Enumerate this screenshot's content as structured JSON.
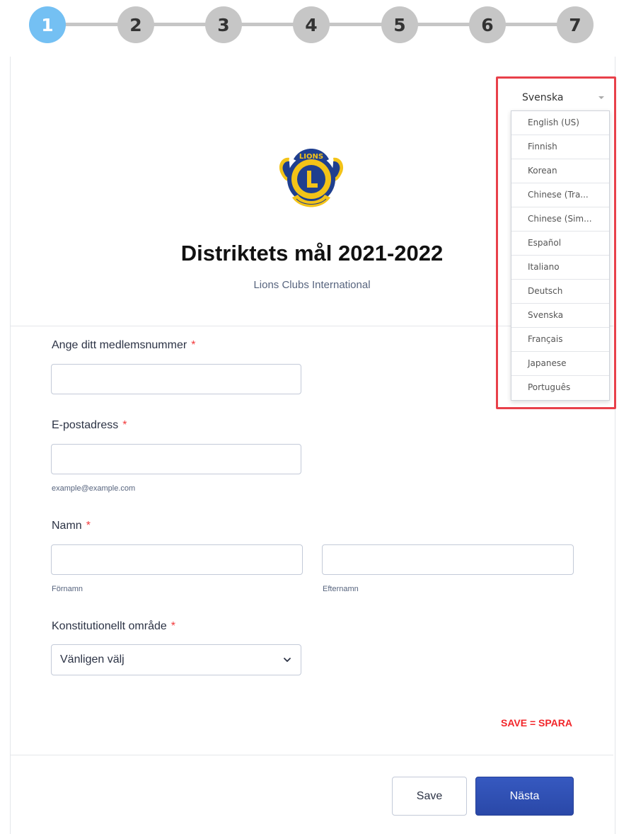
{
  "stepper": {
    "steps": [
      "1",
      "2",
      "3",
      "4",
      "5",
      "6",
      "7"
    ],
    "active": 1,
    "active_color": "#74c0f3",
    "inactive_color": "#c6c6c6"
  },
  "language": {
    "selected": "Svenska",
    "options": [
      "English (US)",
      "Finnish",
      "Korean",
      "Chinese (Tra...",
      "Chinese (Sim...",
      "Español",
      "Italiano",
      "Deutsch",
      "Svenska",
      "Français",
      "Japanese",
      "Português"
    ]
  },
  "header": {
    "title": "Distriktets mål 2021-2022",
    "subtitle": "Lions Clubs International"
  },
  "form": {
    "member_number": {
      "label": "Ange ditt medlemsnummer",
      "required_mark": "*",
      "value": ""
    },
    "email": {
      "label": "E-postadress",
      "required_mark": "*",
      "value": "",
      "hint": "example@example.com"
    },
    "name": {
      "label": "Namn",
      "required_mark": "*",
      "first_value": "",
      "last_value": "",
      "first_sublabel": "Förnamn",
      "last_sublabel": "Efternamn"
    },
    "area": {
      "label": "Konstitutionellt område",
      "required_mark": "*",
      "selected": "Vänligen välj"
    }
  },
  "note": {
    "text": "SAVE = SPARA",
    "color": "#f2262a"
  },
  "buttons": {
    "save_label": "Save",
    "next_label": "Nästa",
    "next_color": "#2e4db0"
  },
  "icons": {
    "select_chevron": "chevron-down-icon",
    "language_caret": "caret-down-icon",
    "logo": "lions-logo"
  }
}
